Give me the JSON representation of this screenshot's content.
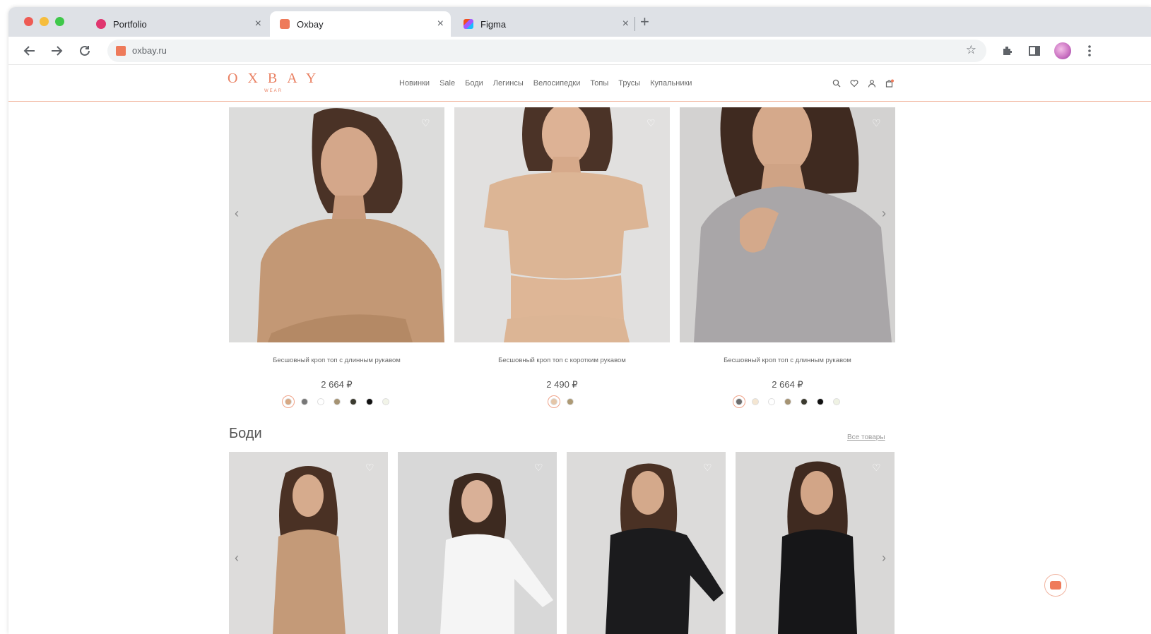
{
  "browser": {
    "tabs": [
      {
        "title": "Portfolio",
        "fav_color": "#e0366f",
        "active": false
      },
      {
        "title": "Oxbay",
        "fav_color": "#ee7a5a",
        "active": true
      },
      {
        "title": "Figma",
        "fav_color": "#a259ff",
        "active": false
      }
    ],
    "close_glyph": "×",
    "new_tab_glyph": "+",
    "url": "oxbay.ru"
  },
  "site": {
    "logo": "OXBAY",
    "logo_sub": "WEAR",
    "nav": [
      "Новинки",
      "Sale",
      "Боди",
      "Легинсы",
      "Велосипедки",
      "Топы",
      "Трусы",
      "Купальники"
    ]
  },
  "products_top": [
    {
      "name": "Бесшовный кроп топ с длинным рукавом",
      "price": "2 664 ₽",
      "swatches": [
        "#d6a884",
        "#777777",
        "#ffffff",
        "#a59373",
        "#3b3a2f",
        "#111111",
        "#f2f4e8"
      ],
      "tone": "#c39875",
      "bg": "#dcdcdb"
    },
    {
      "name": "Бесшовный кроп топ с коротким рукавом",
      "price": "2 490 ₽",
      "swatches": [
        "#e5c6a8",
        "#ad9a75"
      ],
      "tone": "#dcb595",
      "bg": "#e1e0df"
    },
    {
      "name": "Бесшовный кроп топ с длинным рукавом",
      "price": "2 664 ₽",
      "swatches": [
        "#6e6e6e",
        "#f4e6d2",
        "#ffffff",
        "#a59373",
        "#3b3a2f",
        "#111111",
        "#eff2e3"
      ],
      "tone": "#a9a6a8",
      "bg": "#d3d2d1"
    }
  ],
  "section": {
    "title": "Боди",
    "all_link": "Все товары"
  },
  "products_bottom": [
    {
      "tone": "#c49a78",
      "bg": "#dddcdb"
    },
    {
      "tone": "#f5f5f5",
      "bg": "#d8d8d8"
    },
    {
      "tone": "#1b1b1d",
      "bg": "#dcdbda"
    },
    {
      "tone": "#161618",
      "bg": "#d9d8d7"
    }
  ]
}
